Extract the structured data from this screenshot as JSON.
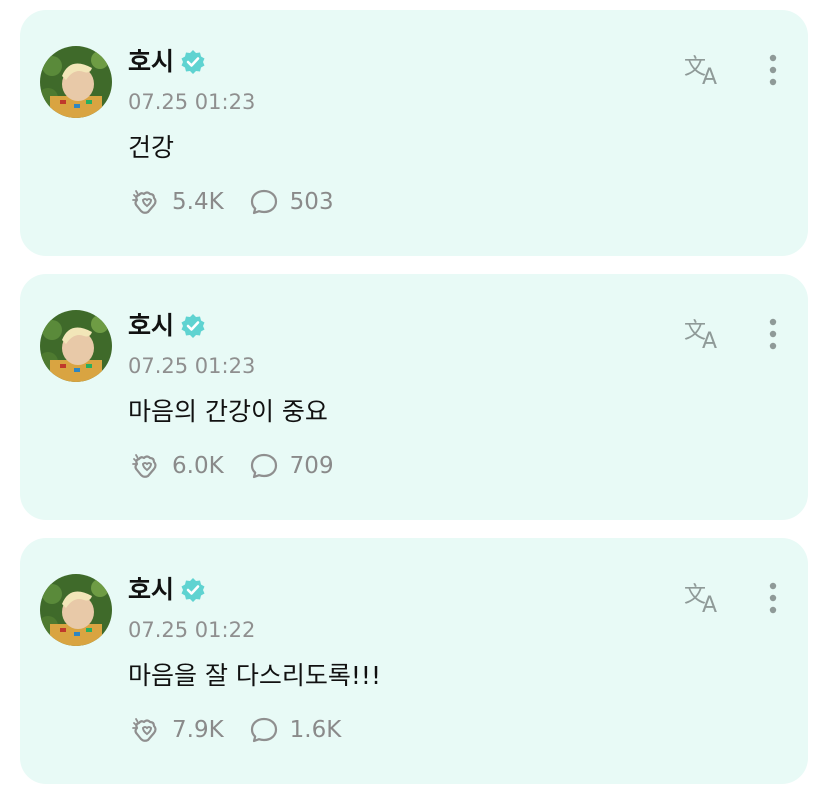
{
  "colors": {
    "card_background": "#e8faf6",
    "verified_badge": "#5fd3d1",
    "secondary_text": "#8f8f8f"
  },
  "posts": [
    {
      "author": "호시",
      "verified": true,
      "time": "07.25 01:23",
      "content": "건강",
      "likes": "5.4K",
      "comments": "503"
    },
    {
      "author": "호시",
      "verified": true,
      "time": "07.25 01:23",
      "content": "마음의 간강이 중요",
      "likes": "6.0K",
      "comments": "709"
    },
    {
      "author": "호시",
      "verified": true,
      "time": "07.25 01:22",
      "content": "마음을 잘 다스리도록!!!",
      "likes": "7.9K",
      "comments": "1.6K"
    }
  ],
  "icons": {
    "like": "clap-heart-icon",
    "comment": "speech-bubble-icon",
    "translate": "translate-icon",
    "more": "more-vertical-icon",
    "verified": "verified-badge-icon"
  }
}
